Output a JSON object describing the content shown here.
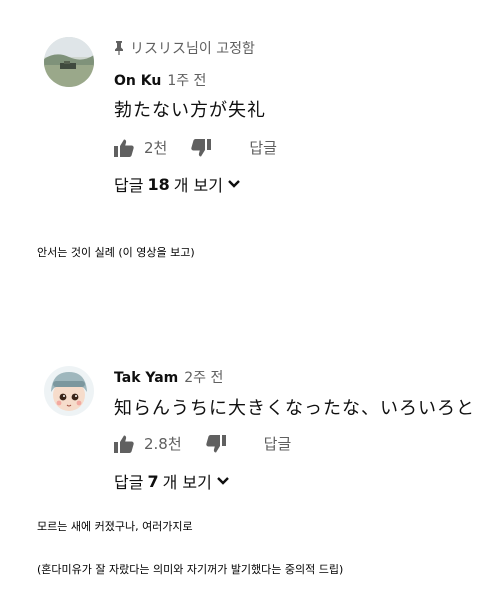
{
  "comments": [
    {
      "pinned_label": "リスリス님이 고정함",
      "author": "On Ku",
      "time": "1주 전",
      "text": "勃たない方が失礼",
      "likes": "2천",
      "reply_label": "답글",
      "replies": {
        "prefix": "답글 ",
        "count": "18",
        "suffix": "개 보기"
      }
    },
    {
      "author": "Tak Yam",
      "time": "2주 전",
      "text": "知らんうちに大きくなったな、いろいろと",
      "likes": "2.8천",
      "reply_label": "답글",
      "replies": {
        "prefix": "답글 ",
        "count": "7",
        "suffix": "개 보기"
      }
    }
  ],
  "captions": [
    "안서는 것이 실례 (이 영상을 보고)",
    "모르는 새에 커졌구나, 여러가지로",
    "(혼다미유가 잘 자랐다는 의미와 자기꺼가 발기했다는 중의적 드립)"
  ],
  "icons": {
    "pin": "pin-icon",
    "like": "thumbs-up-icon",
    "dislike": "thumbs-down-icon",
    "expand": "chevron-down-icon"
  },
  "colors": {
    "text": "#0f0f0f",
    "secondary": "#606060",
    "background": "#ffffff"
  }
}
